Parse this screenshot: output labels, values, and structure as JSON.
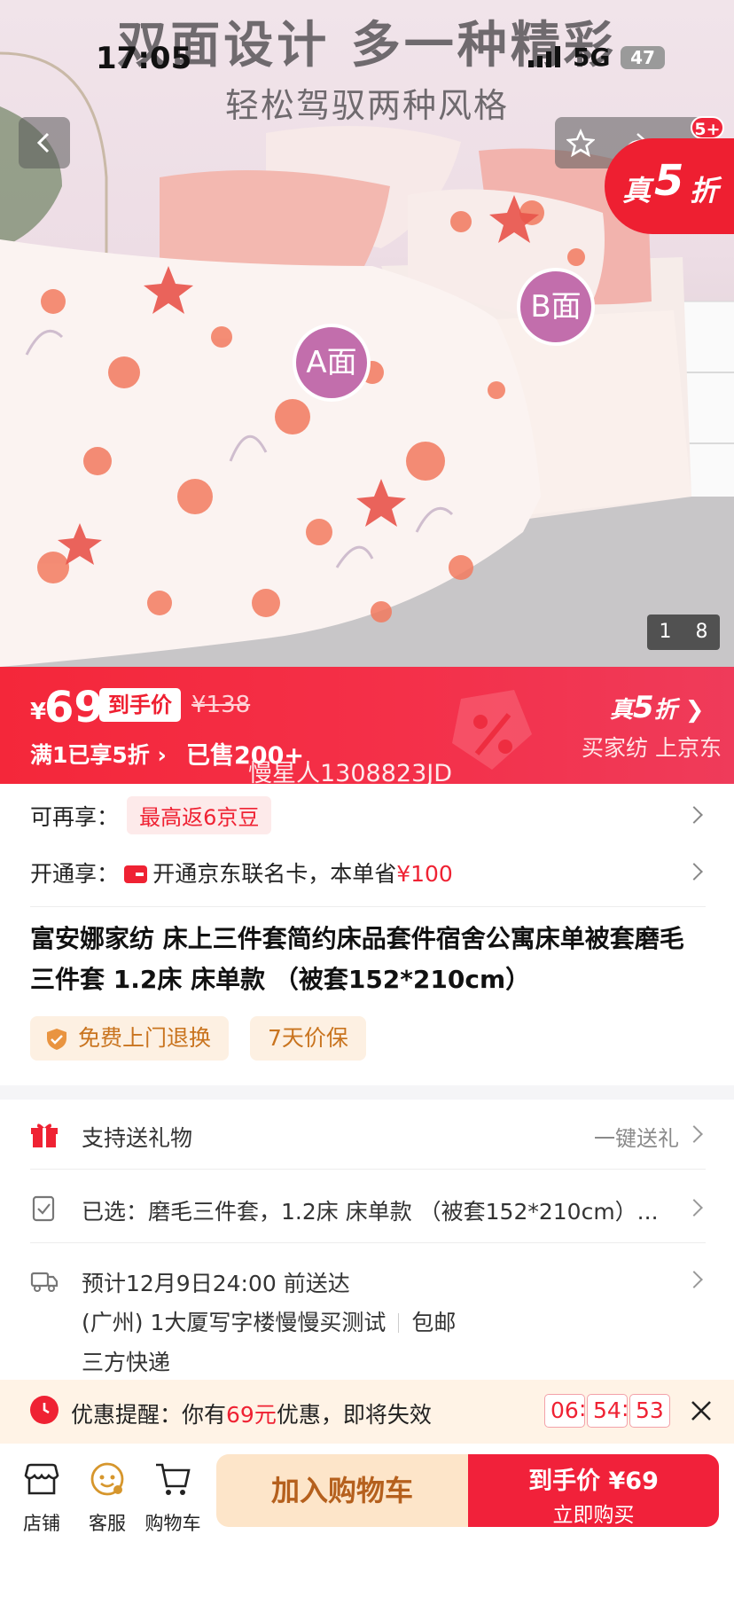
{
  "status_bar": {
    "time": "17:05",
    "network": "5G",
    "battery": "47"
  },
  "hero": {
    "headline": "双面设计 多一种精彩",
    "subheadline": "轻松驾驭两种风格",
    "badge_a": "A面",
    "badge_b": "B面",
    "promo_badge": {
      "prefix": "真",
      "number": "5",
      "suffix": "折"
    },
    "cart_count": "5+",
    "pager": {
      "current": "1",
      "total": "8"
    }
  },
  "price_bar": {
    "currency": "¥",
    "price": "69",
    "price_tag": "到手价",
    "original_price": "¥138",
    "promo": "满1已享5折",
    "sold": "已售200+",
    "zhen_prefix": "真",
    "zhen_number": "5",
    "zhen_suffix": "折",
    "slogan": "买家纺 上京东",
    "watermark": "慢星人1308823JD"
  },
  "benefits": [
    {
      "label": "可再享：",
      "value": "最高返6京豆"
    },
    {
      "label": "开通享：",
      "value_pre": "开通京东联名卡，本单省",
      "value_amount": "¥100"
    }
  ],
  "product": {
    "title": "富安娜家纺 床上三件套简约床品套件宿舍公寓床单被套磨毛三件套 1.2床 床单款 （被套152*210cm）",
    "chips": [
      "免费上门退换",
      "7天价保"
    ]
  },
  "features": {
    "gift": {
      "label": "支持送礼物",
      "action": "一键送礼"
    },
    "selected": {
      "label": "已选：磨毛三件套，1.2床 床单款 （被套152*210cm）..."
    },
    "delivery": {
      "eta": "预计12月9日24:00 前送达",
      "address": "(广州) 1大厦写字楼慢慢买测试",
      "shipping_fee": "包邮",
      "carrier": "三方快递"
    }
  },
  "reminder": {
    "prefix": "优惠提醒：你有",
    "amount": "69元",
    "suffix": "优惠，即将失效",
    "hours": "06",
    "minutes": "54",
    "seconds": "53"
  },
  "bottom_bar": {
    "store": "店铺",
    "service": "客服",
    "cart": "购物车",
    "add_to_cart": "加入购物车",
    "buy_line1": "到手价 ¥69",
    "buy_line2": "立即购买"
  },
  "colors": {
    "accent": "#f1213a",
    "cart_button": "#fde5c9",
    "chip_text": "#c9741f"
  }
}
